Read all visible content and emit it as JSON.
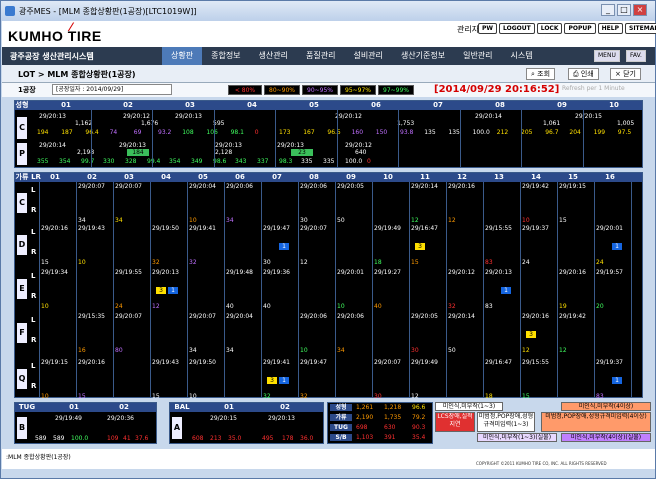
{
  "window": {
    "title": "광주MES - [MLM 종합상황판(1공장)[LTC1019W]]"
  },
  "header": {
    "logo": "KUMHO TIRE",
    "admin_label": "관리자",
    "buttons": [
      "PW",
      "LOGOUT",
      "LOCK",
      "POPUP",
      "HELP",
      "SITEMAP"
    ]
  },
  "nav": {
    "system_name": "광주공장 생산관리시스템",
    "items": [
      "상황판",
      "종합정보",
      "생산관리",
      "품질관리",
      "설비관리",
      "생산기준정보",
      "일반관리",
      "시스템"
    ],
    "active_index": 0,
    "menu_label": "MENU",
    "fav_label": "FAV."
  },
  "breadcrumb": {
    "title": "LOT > MLM 종합상황판(1공장)",
    "search": "조회",
    "print": "인쇄",
    "close": "닫기"
  },
  "filter": {
    "plant": "1공장",
    "date_text": "[공장일자 : 2014/09/29]",
    "legend": [
      {
        "label": "< 80%",
        "bg": "#000000",
        "fg": "#ff3030"
      },
      {
        "label": "80~90%",
        "bg": "#000000",
        "fg": "#ff9a00"
      },
      {
        "label": "90~95%",
        "bg": "#000000",
        "fg": "#c070ff"
      },
      {
        "label": "95~97%",
        "bg": "#000000",
        "fg": "#ffe000"
      },
      {
        "label": "97~99%",
        "bg": "#000000",
        "fg": "#40ff60"
      }
    ],
    "clock": "[2014/09/29 20:16:52]",
    "refresh": "Refresh per 1 Minute"
  },
  "seongeui": {
    "corner": "성형",
    "columns": [
      "01",
      "02",
      "03",
      "04",
      "05",
      "06",
      "07",
      "08",
      "09",
      "10"
    ],
    "rows": [
      "C",
      "P"
    ],
    "c_times": [
      "29/20:13",
      "29/20:12",
      "29/20:13",
      "",
      "29/20:12",
      "29/20:14",
      "29/20:15"
    ],
    "c_line1": [
      "1,162",
      "1,676",
      "595",
      "",
      "1,753",
      "1,061",
      "1,005"
    ],
    "c_nums": [
      "194",
      "187",
      "96.4",
      "74",
      "69",
      "93.2",
      "108",
      "106",
      "98.1",
      "0",
      "173",
      "167",
      "96.5",
      "160",
      "150",
      "93.8",
      "135",
      "135",
      "100.0",
      "212",
      "205",
      "96.7",
      "204",
      "199",
      "97.5"
    ],
    "p_times": [
      "29/20:14",
      "29/20:13",
      "29/20:13",
      "29/20:13",
      "29/20:12"
    ],
    "p_line1": [
      "2,198",
      "184",
      "2,128",
      "23",
      "640"
    ],
    "p_nums": [
      "355",
      "354",
      "99.7",
      "330",
      "328",
      "99.4",
      "354",
      "349",
      "98.6",
      "343",
      "337",
      "98.3",
      "335",
      "335",
      "100.0",
      "0"
    ]
  },
  "gaeyu": {
    "corner": "가류",
    "lr": "LR",
    "columns": [
      "01",
      "02",
      "03",
      "04",
      "05",
      "06",
      "07",
      "08",
      "09",
      "10",
      "11",
      "12",
      "13",
      "14",
      "15",
      "16"
    ],
    "rows": [
      "C",
      "D",
      "E",
      "F",
      "Q"
    ],
    "sub": [
      "L",
      "R"
    ],
    "times_sample": [
      "29/20:07",
      "29/20:07",
      "29/20:04",
      "29/20:06",
      "29/20:06",
      "29/20:05",
      "29/20:14",
      "29/20:16",
      "29/19:42",
      "29/19:15",
      "29/20:16",
      "29/19:43",
      "29/19:50",
      "29/19:41",
      "29/19:47",
      "29/20:07",
      "29/19:49",
      "29/16:47",
      "29/15:55",
      "29/19:37",
      "29/20:01",
      "29/19:34",
      "29/19:55",
      "29/20:13",
      "29/19:48",
      "29/19:36",
      "29/20:01",
      "29/19:27",
      "29/20:12",
      "29/20:13",
      "29/20:16",
      "29/19:57",
      "29/15:35"
    ],
    "values_sample": [
      "34",
      "34",
      "10",
      "34",
      "30",
      "50",
      "12",
      "12",
      "10",
      "15",
      "15",
      "10",
      "32",
      "32",
      "30",
      "12",
      "18",
      "15",
      "83",
      "24",
      "24",
      "10",
      "24",
      "12",
      "40",
      "40",
      "10",
      "40",
      "32",
      "83",
      "19",
      "20",
      "16",
      "80"
    ]
  },
  "tug": {
    "label": "TUG",
    "row": "B",
    "col1": "01",
    "col2": "02",
    "times": [
      "29/19:49",
      "29/20:36"
    ],
    "nums": [
      "589",
      "589",
      "100.0",
      "109",
      "41",
      "37.6"
    ]
  },
  "bal": {
    "label": "BAL",
    "row": "A",
    "col1": "01",
    "col2": "02",
    "times": [
      "29/20:15",
      "29/20:13"
    ],
    "nums": [
      "608",
      "213",
      "35.0",
      "495",
      "178",
      "36.0"
    ]
  },
  "summary": {
    "rows": [
      {
        "label": "성형",
        "v1": "1,261",
        "v2": "1,218",
        "v3": "96.6"
      },
      {
        "label": "가류",
        "v1": "2,190",
        "v2": "1,735",
        "v3": "79.2"
      },
      {
        "label": "TUG",
        "v1": "698",
        "v2": "630",
        "v3": "90.3"
      },
      {
        "label": "S/B",
        "v1": "1,103",
        "v2": "391",
        "v3": "35.4"
      }
    ]
  },
  "legend_tabs": [
    {
      "text": "미인식,미부착(1~3)",
      "bg": "#ffffff",
      "fg": "#000000"
    },
    {
      "text": "LCS장애,실적지연",
      "bg": "#e03030",
      "fg": "#ffffff"
    },
    {
      "text": "미범정,POP장애,성형규격미입력(1~3)",
      "bg": "#ffffff",
      "fg": "#000000"
    },
    {
      "text": "미인식,미부착(4이상)",
      "bg": "#ff9a6a",
      "fg": "#000000"
    },
    {
      "text": "미범정,POP장애,성형규격미입력(4이상)",
      "bg": "#ff9a6a",
      "fg": "#000000"
    },
    {
      "text": "미인식,미부착(1~3)(실물)",
      "bg": "#e8d8ff",
      "fg": "#000000"
    },
    {
      "text": "미인식,미부착(4이상)(실물)",
      "bg": "#c080ff",
      "fg": "#000000"
    }
  ],
  "footer": {
    "tab": ":MLM 종합상황판(1공장)",
    "copyright": "COPYRIGHT ©2011 KUMHO TIRE CO, INC. ALL RIGHTS RESERVED"
  }
}
